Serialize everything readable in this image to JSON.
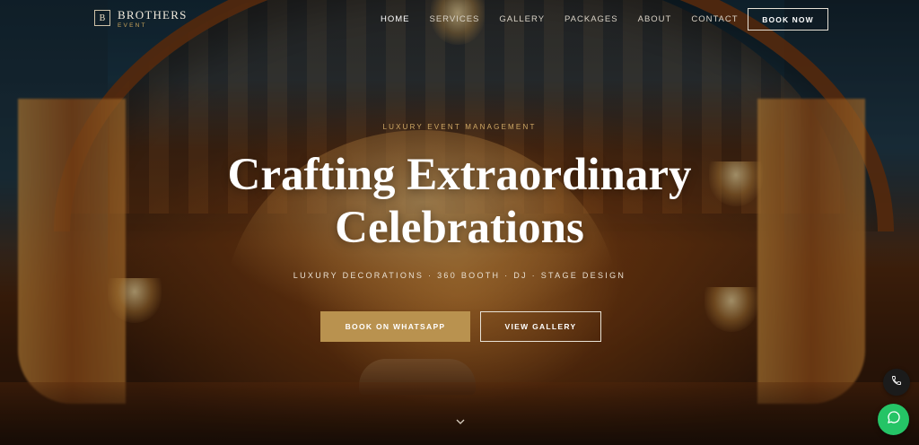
{
  "brand": {
    "name": "BROTHERS",
    "sub": "EVENT",
    "mark": "B"
  },
  "nav": {
    "items": [
      {
        "label": "HOME",
        "active": true
      },
      {
        "label": "SERVICES",
        "active": false
      },
      {
        "label": "GALLERY",
        "active": false
      },
      {
        "label": "PACKAGES",
        "active": false
      },
      {
        "label": "ABOUT",
        "active": false
      },
      {
        "label": "CONTACT",
        "active": false
      }
    ],
    "cta_label": "BOOK NOW"
  },
  "hero": {
    "eyebrow": "LUXURY EVENT MANAGEMENT",
    "headline_line1": "Crafting Extraordinary",
    "headline_line2": "Celebrations",
    "tagline": "LUXURY DECORATIONS · 360 BOOTH · DJ · STAGE DESIGN",
    "primary_cta": "BOOK ON WHATSAPP",
    "secondary_cta": "VIEW GALLERY",
    "scroll_icon": "chevron-down-icon"
  },
  "floating": {
    "phone_icon": "phone-icon",
    "chat_icon": "whatsapp-chat-icon"
  },
  "colors": {
    "accent_gold": "#b9924f",
    "eyebrow_gold": "#cfa865",
    "chat_green": "#25c466",
    "phone_bg": "#1b1b1b"
  }
}
